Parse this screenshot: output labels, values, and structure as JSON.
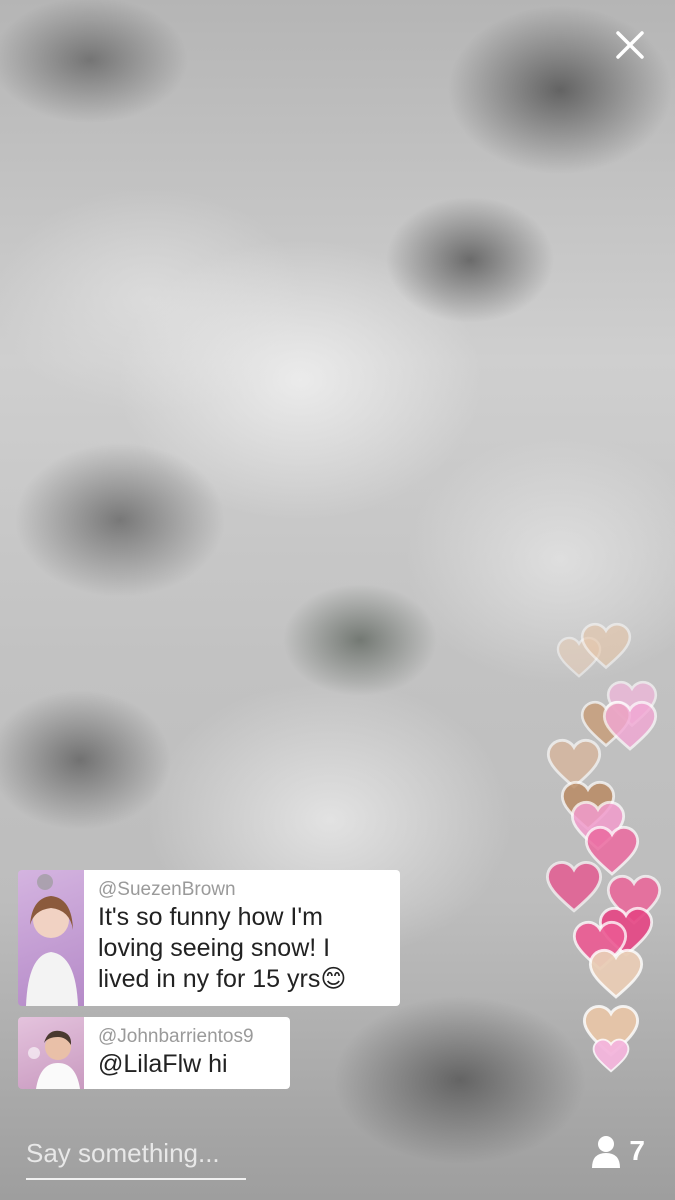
{
  "header": {
    "close_icon": "close-icon"
  },
  "comments": [
    {
      "username": "@SuezenBrown",
      "text": "It's so funny how I'm loving seeing snow! I lived in ny for 15 yrs😊"
    },
    {
      "username": "@Johnbarrientos9",
      "text": "@LilaFlw hi"
    }
  ],
  "composer": {
    "placeholder": "Say something..."
  },
  "viewers": {
    "icon": "person-icon",
    "count": "7"
  },
  "hearts": {
    "colors": [
      "#e9cdb6",
      "#e7c6a8",
      "#f4b6dd",
      "#c89a72",
      "#f2a7d4",
      "#d8b59a",
      "#b9875e",
      "#f29ccd",
      "#ec6aa0",
      "#e94f8c",
      "#ee5f97",
      "#e64584",
      "#ec5a93"
    ]
  }
}
